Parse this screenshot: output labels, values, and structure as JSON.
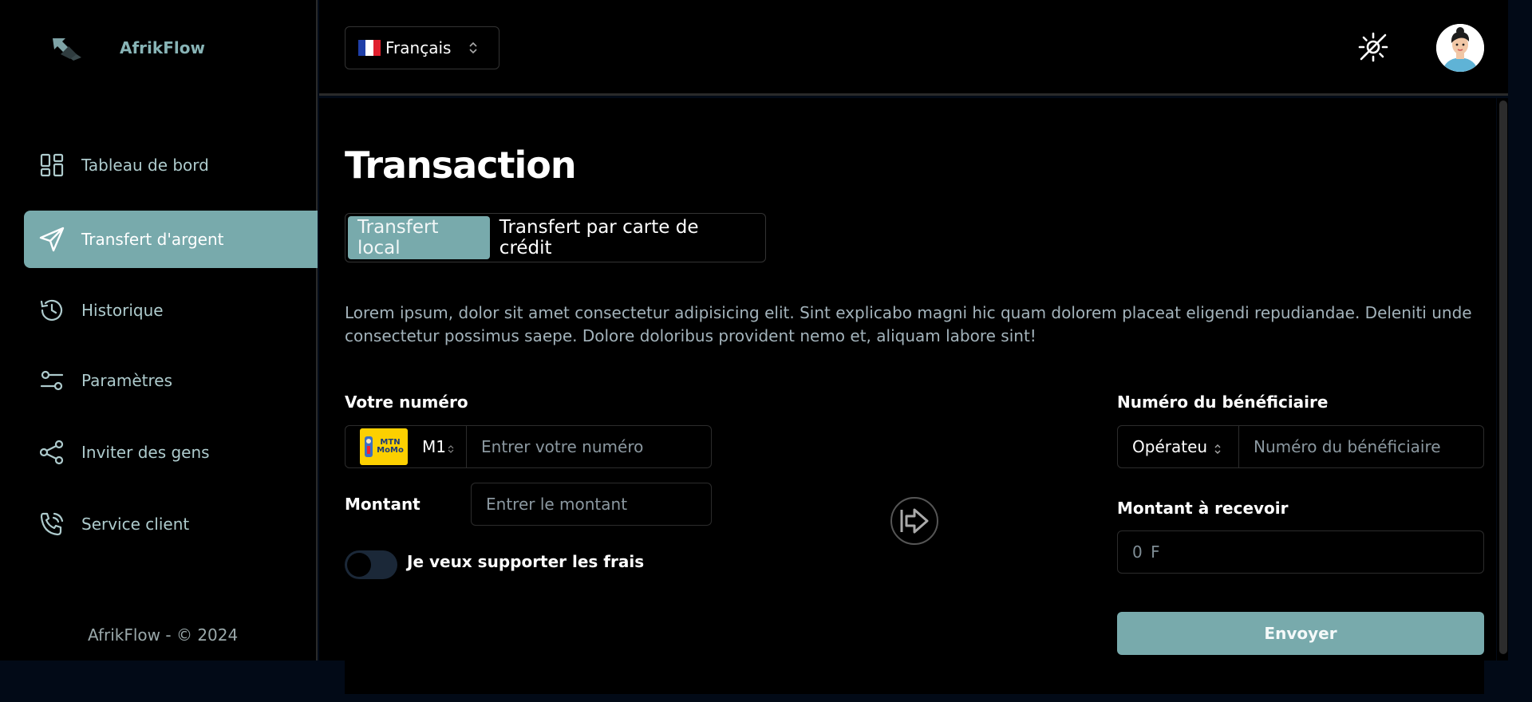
{
  "brand": {
    "name": "AfrikFlow"
  },
  "sidebar": {
    "items": [
      {
        "label": "Tableau de bord",
        "icon": "dashboard-icon"
      },
      {
        "label": "Transfert d'argent",
        "icon": "send-icon",
        "active": true
      },
      {
        "label": "Historique",
        "icon": "history-icon"
      },
      {
        "label": "Paramètres",
        "icon": "settings-sliders-icon"
      },
      {
        "label": "Inviter des gens",
        "icon": "share-icon"
      },
      {
        "label": "Service client",
        "icon": "phone-call-icon"
      }
    ],
    "footer": "AfrikFlow - © 2024"
  },
  "header": {
    "language": {
      "label": "Français",
      "icon": "france-flag-icon"
    },
    "theme_icon": "theme-toggle-icon",
    "avatar_icon": "user-avatar"
  },
  "main": {
    "title": "Transaction",
    "tabs": [
      {
        "label": "Transfert local",
        "active": true
      },
      {
        "label": "Transfert par carte de crédit"
      }
    ],
    "description": "Lorem ipsum, dolor sit amet consectetur adipisicing elit. Sint explicabo magni hic quam dolorem placeat eligendi repudiandae. Deleniti unde consectetur possimus saepe. Dolore doloribus provident nemo et, aliquam labore sint!",
    "sender": {
      "label": "Votre numéro",
      "operator_code": "M1",
      "operator_logo_text": "MTN MoMo",
      "number_placeholder": "Entrer votre numéro",
      "amount_label": "Montant",
      "amount_placeholder": "Entrer le montant",
      "fees_toggle_label": "Je veux supporter les frais",
      "fees_toggle_on": false
    },
    "beneficiary": {
      "label": "Numéro du bénéficiaire",
      "operator_select": "Opérateu",
      "number_placeholder": "Numéro du bénéficiaire",
      "receive_label": "Montant à recevoir",
      "receive_value": "0 F"
    },
    "send_button": "Envoyer"
  },
  "colors": {
    "accent": "#78aaac",
    "background": "#000000",
    "page_bg": "#020a17"
  }
}
